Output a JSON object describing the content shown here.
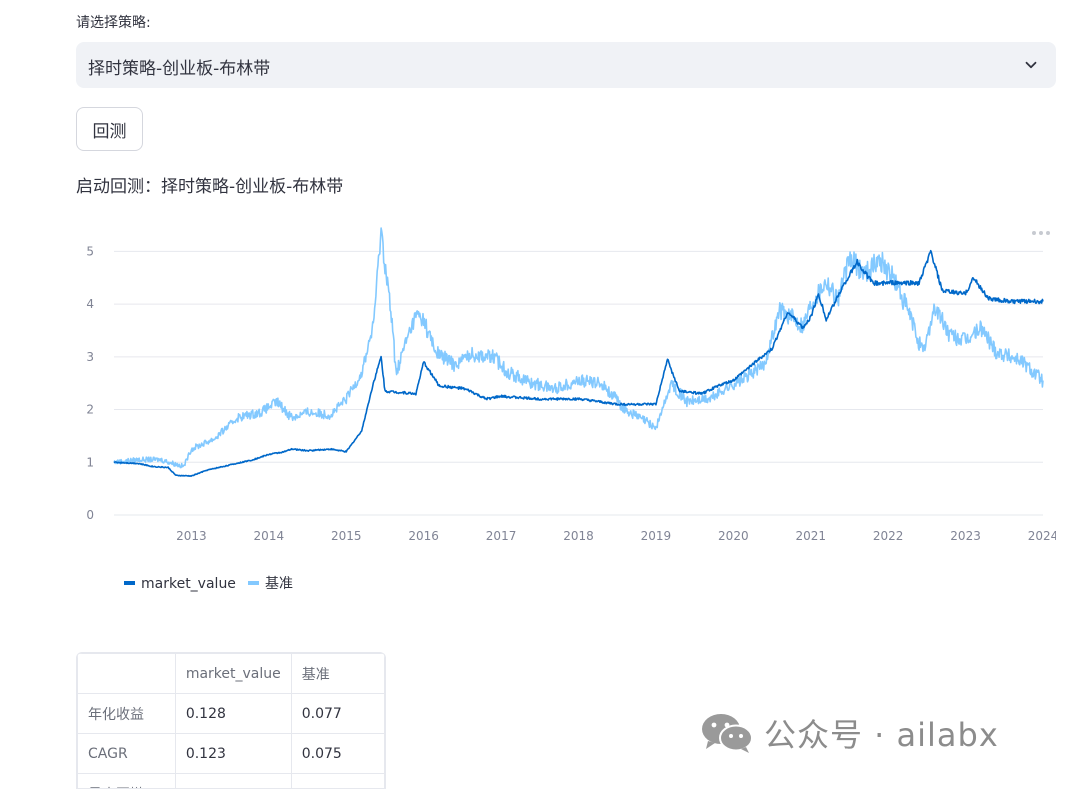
{
  "form": {
    "label": "请选择策略:",
    "selected_strategy": "择时策略-创业板-布林带",
    "backtest_button": "回测",
    "status_text": "启动回测：择时策略-创业板-布林带"
  },
  "chart_data": {
    "type": "line",
    "x_ticks": [
      "2013",
      "2014",
      "2015",
      "2016",
      "2017",
      "2018",
      "2019",
      "2020",
      "2021",
      "2022",
      "2023",
      "2024"
    ],
    "y_ticks": [
      0,
      1,
      2,
      3,
      4,
      5
    ],
    "xlim": [
      2012.0,
      2024.0
    ],
    "ylim": [
      0,
      5.5
    ],
    "grid": "horizontal",
    "legend_placement": "bottom-left",
    "series": [
      {
        "name": "market_value",
        "color": "#0068c9",
        "points": [
          [
            2012.0,
            1.0
          ],
          [
            2012.3,
            0.98
          ],
          [
            2012.5,
            0.92
          ],
          [
            2012.7,
            0.9
          ],
          [
            2012.8,
            0.75
          ],
          [
            2013.0,
            0.74
          ],
          [
            2013.2,
            0.85
          ],
          [
            2013.5,
            0.95
          ],
          [
            2013.8,
            1.05
          ],
          [
            2014.0,
            1.15
          ],
          [
            2014.2,
            1.2
          ],
          [
            2014.3,
            1.25
          ],
          [
            2014.5,
            1.22
          ],
          [
            2014.8,
            1.25
          ],
          [
            2015.0,
            1.2
          ],
          [
            2015.2,
            1.6
          ],
          [
            2015.35,
            2.5
          ],
          [
            2015.45,
            3.0
          ],
          [
            2015.5,
            2.35
          ],
          [
            2015.9,
            2.3
          ],
          [
            2016.0,
            2.9
          ],
          [
            2016.2,
            2.45
          ],
          [
            2016.5,
            2.4
          ],
          [
            2016.6,
            2.35
          ],
          [
            2016.8,
            2.2
          ],
          [
            2017.0,
            2.25
          ],
          [
            2017.5,
            2.2
          ],
          [
            2018.0,
            2.2
          ],
          [
            2018.5,
            2.1
          ],
          [
            2019.0,
            2.1
          ],
          [
            2019.15,
            2.95
          ],
          [
            2019.3,
            2.35
          ],
          [
            2019.6,
            2.3
          ],
          [
            2019.8,
            2.45
          ],
          [
            2020.0,
            2.55
          ],
          [
            2020.2,
            2.8
          ],
          [
            2020.5,
            3.15
          ],
          [
            2020.7,
            3.85
          ],
          [
            2020.9,
            3.55
          ],
          [
            2021.0,
            3.75
          ],
          [
            2021.1,
            4.2
          ],
          [
            2021.2,
            3.7
          ],
          [
            2021.4,
            4.3
          ],
          [
            2021.6,
            4.8
          ],
          [
            2021.8,
            4.4
          ],
          [
            2022.0,
            4.4
          ],
          [
            2022.4,
            4.4
          ],
          [
            2022.55,
            5.0
          ],
          [
            2022.7,
            4.25
          ],
          [
            2023.0,
            4.2
          ],
          [
            2023.1,
            4.5
          ],
          [
            2023.3,
            4.1
          ],
          [
            2023.6,
            4.05
          ],
          [
            2024.0,
            4.05
          ]
        ]
      },
      {
        "name": "基准",
        "color": "#83c9ff",
        "points": [
          [
            2012.0,
            1.0
          ],
          [
            2012.3,
            1.05
          ],
          [
            2012.6,
            1.05
          ],
          [
            2012.9,
            0.92
          ],
          [
            2013.0,
            1.25
          ],
          [
            2013.3,
            1.45
          ],
          [
            2013.6,
            1.85
          ],
          [
            2013.9,
            1.95
          ],
          [
            2014.1,
            2.15
          ],
          [
            2014.3,
            1.85
          ],
          [
            2014.5,
            1.95
          ],
          [
            2014.8,
            1.9
          ],
          [
            2015.0,
            2.2
          ],
          [
            2015.2,
            2.7
          ],
          [
            2015.35,
            3.6
          ],
          [
            2015.45,
            5.4
          ],
          [
            2015.55,
            4.2
          ],
          [
            2015.65,
            2.7
          ],
          [
            2015.75,
            3.2
          ],
          [
            2015.9,
            3.8
          ],
          [
            2016.0,
            3.7
          ],
          [
            2016.15,
            3.1
          ],
          [
            2016.4,
            2.85
          ],
          [
            2016.6,
            3.05
          ],
          [
            2016.9,
            3.0
          ],
          [
            2017.1,
            2.7
          ],
          [
            2017.4,
            2.5
          ],
          [
            2017.7,
            2.4
          ],
          [
            2018.0,
            2.55
          ],
          [
            2018.3,
            2.5
          ],
          [
            2018.6,
            2.0
          ],
          [
            2018.9,
            1.75
          ],
          [
            2019.0,
            1.65
          ],
          [
            2019.2,
            2.5
          ],
          [
            2019.4,
            2.15
          ],
          [
            2019.7,
            2.2
          ],
          [
            2019.9,
            2.4
          ],
          [
            2020.1,
            2.55
          ],
          [
            2020.4,
            2.85
          ],
          [
            2020.6,
            3.9
          ],
          [
            2020.9,
            3.6
          ],
          [
            2021.0,
            4.0
          ],
          [
            2021.2,
            4.45
          ],
          [
            2021.35,
            4.1
          ],
          [
            2021.5,
            4.85
          ],
          [
            2021.7,
            4.6
          ],
          [
            2021.9,
            4.85
          ],
          [
            2022.1,
            4.4
          ],
          [
            2022.3,
            3.7
          ],
          [
            2022.45,
            3.05
          ],
          [
            2022.6,
            3.95
          ],
          [
            2022.8,
            3.4
          ],
          [
            2023.0,
            3.3
          ],
          [
            2023.2,
            3.55
          ],
          [
            2023.4,
            3.1
          ],
          [
            2023.7,
            2.95
          ],
          [
            2024.0,
            2.55
          ]
        ]
      }
    ]
  },
  "metrics_table": {
    "columns": [
      "",
      "market_value",
      "基准"
    ],
    "rows": [
      {
        "label": "年化收益",
        "market_value": "0.128",
        "benchmark": "0.077"
      },
      {
        "label": "CAGR",
        "market_value": "0.123",
        "benchmark": "0.075"
      },
      {
        "label": "最大回撤",
        "market_value": "",
        "benchmark": ""
      }
    ]
  },
  "watermark": {
    "text": "公众号 · ailabx",
    "icon": "wechat-icon"
  },
  "icons": {
    "chart_menu": "more-horizontal-icon",
    "select_chevron": "chevron-down-icon"
  }
}
